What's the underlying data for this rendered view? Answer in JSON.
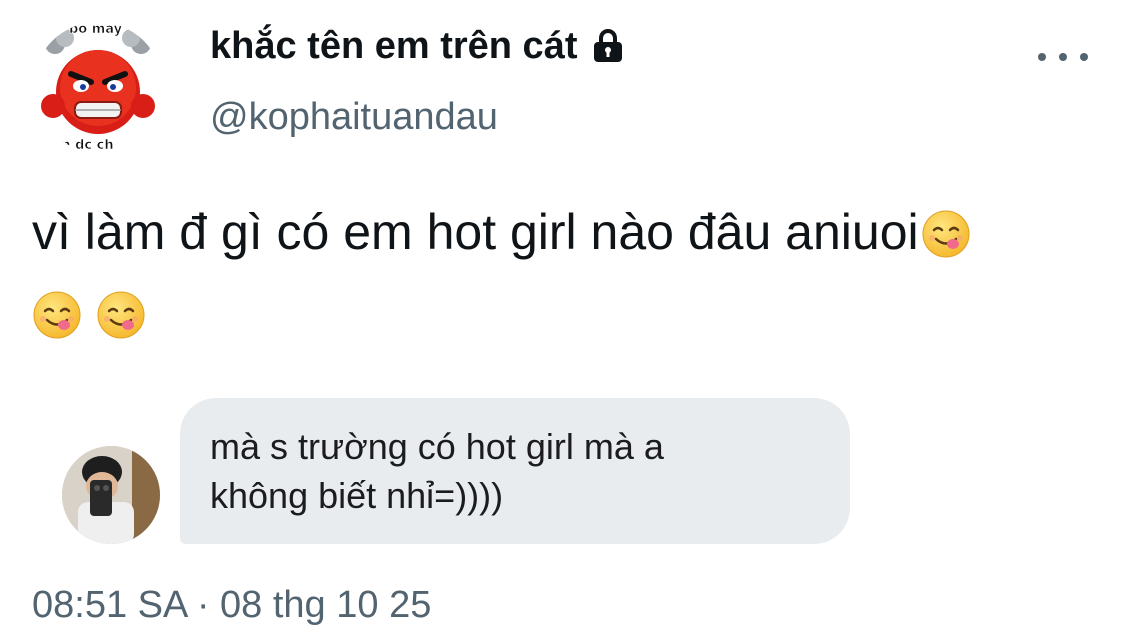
{
  "author": {
    "display_name": "khắc tên em trên cát",
    "handle": "@kophaituandau",
    "avatar_caption_top": "bo may",
    "avatar_caption_bottom": "m dc ch",
    "protected_icon": "lock-icon"
  },
  "menu": {
    "icon": "more-icon"
  },
  "tweet": {
    "text": "vì làm đ gì có em hot girl nào đâu aniuoi",
    "emoji_name": "face-savoring-food-emoji",
    "emoji_count_inline": 1,
    "emoji_count_second_line": 2
  },
  "quoted_message": {
    "line1": "mà s trường có hot girl mà a",
    "line2": "không biết nhỉ=))))"
  },
  "timestamp": {
    "time": "08:51 SA",
    "separator": "·",
    "date": "08 thg 10 25"
  },
  "colors": {
    "text_primary": "#0f1419",
    "text_secondary": "#536471",
    "bubble_bg": "#e8ecef"
  }
}
